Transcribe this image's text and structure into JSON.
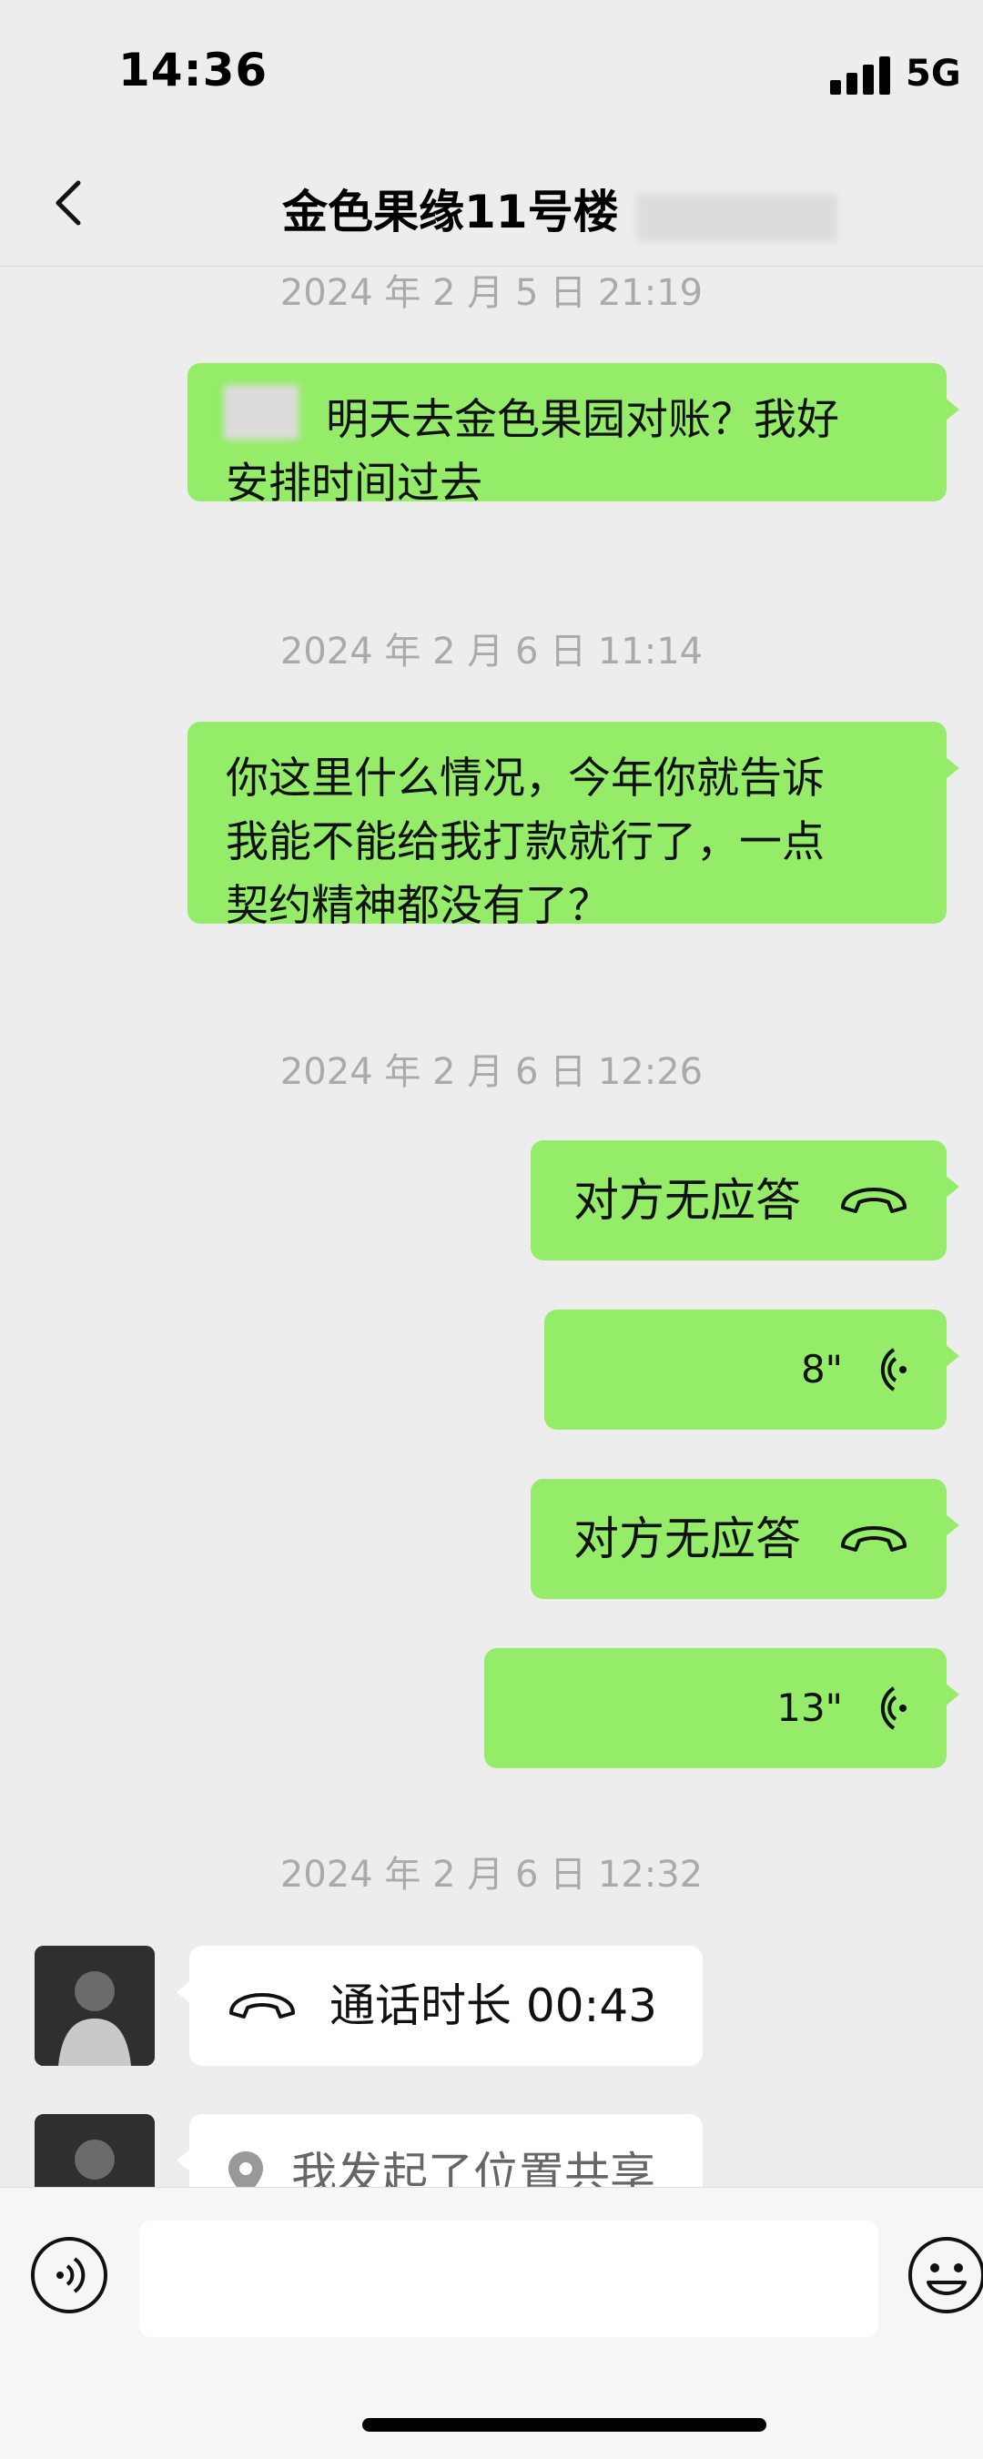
{
  "status_bar": {
    "time": "14:36",
    "network": "5G"
  },
  "nav": {
    "title": "金色果缘11号楼"
  },
  "messages": [
    {
      "type": "timestamp",
      "text": "2024 年 2 月 5 日 21:19"
    },
    {
      "type": "text",
      "lines": [
        "明天去金色果园对账？我好",
        "安排时间过去"
      ]
    },
    {
      "type": "timestamp",
      "text": "2024 年 2 月 6 日 11:14"
    },
    {
      "type": "text",
      "lines": [
        "你这里什么情况，今年你就告诉",
        "我能不能给我打款就行了，一点",
        "契约精神都没有了？"
      ]
    },
    {
      "type": "timestamp",
      "text": "2024 年 2 月 6 日 12:26"
    },
    {
      "type": "call",
      "label": "对方无应答"
    },
    {
      "type": "voice",
      "duration": "8\""
    },
    {
      "type": "call",
      "label": "对方无应答"
    },
    {
      "type": "voice",
      "duration": "13\""
    },
    {
      "type": "timestamp",
      "text": "2024 年 2 月 6 日 12:32"
    },
    {
      "type": "call_in",
      "label": "通话时长 00:43"
    },
    {
      "type": "location",
      "label": "我发起了位置共享"
    }
  ],
  "icons": {
    "back": "chevron-left-icon",
    "call": "hang-up-phone-icon",
    "voice": "voice-wave-icon",
    "location": "location-pin-icon",
    "voice_toggle": "voice-input-icon",
    "emoji": "emoji-icon"
  },
  "colors": {
    "background": "#ededed",
    "outgoing_bubble": "#95ec69",
    "incoming_bubble": "#ffffff",
    "timestamp": "#aaaaaa"
  }
}
